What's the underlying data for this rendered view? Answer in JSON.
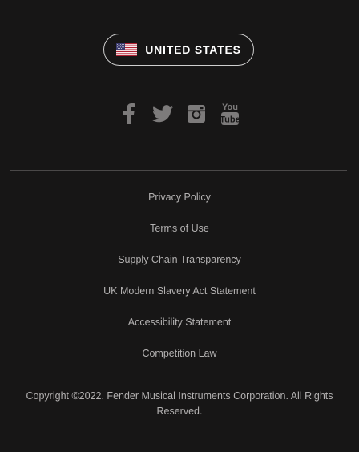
{
  "region": {
    "label": "UNITED STATES",
    "flag_icon": "us-flag-icon"
  },
  "social": {
    "icons": [
      "facebook-icon",
      "twitter-icon",
      "instagram-icon",
      "youtube-icon"
    ],
    "icon_color": "#7d7b7b",
    "youtube_top": "You",
    "youtube_bottom": "Tube"
  },
  "links": [
    "Privacy Policy",
    "Terms of Use",
    "Supply Chain Transparency",
    "UK Modern Slavery Act Statement",
    "Accessibility Statement",
    "Competition Law"
  ],
  "copyright": "Copyright ©2022. Fender Musical Instruments Corporation. All Rights Reserved.",
  "colors": {
    "background": "#171616",
    "text": "#b3b1b1",
    "divider": "#4a4848"
  }
}
